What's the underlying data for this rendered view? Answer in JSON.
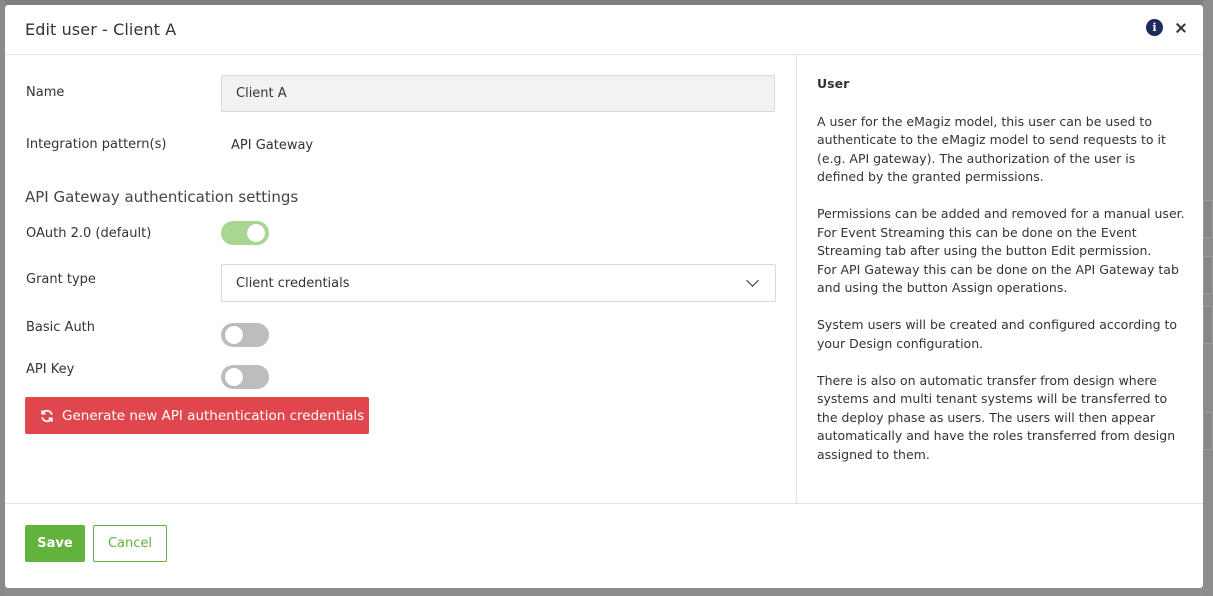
{
  "modal": {
    "title": "Edit user - Client A"
  },
  "form": {
    "name_label": "Name",
    "name_value": "Client A",
    "pattern_label": "Integration pattern(s)",
    "pattern_value": "API Gateway",
    "section_title": "API Gateway authentication settings",
    "oauth_label": "OAuth 2.0 (default)",
    "oauth_enabled": true,
    "grant_label": "Grant type",
    "grant_value": "Client credentials",
    "basic_label": "Basic Auth",
    "basic_enabled": false,
    "apikey_label": "API Key",
    "apikey_enabled": false,
    "generate_label": "Generate new API authentication credentials"
  },
  "help": {
    "title": "User",
    "p1": "A user for the eMagiz model, this user can be used to authenticate to the eMagiz model to send requests to it (e.g. API gateway). The authorization of the user is defined by the granted permissions.",
    "p2a": "Permissions can be added and removed for a manual user.",
    "p2b": "For Event Streaming this can be done on the Event Streaming tab after using the button Edit permission.",
    "p2c": "For API Gateway this can be done on the API Gateway tab and using the button Assign operations.",
    "p3": "System users will be created and configured according to your Design configuration.",
    "p4": "There is also on automatic transfer from design where systems and multi tenant systems will be transferred to the deploy phase as users. The users will then appear automatically and have the roles transferred from design assigned to them."
  },
  "footer": {
    "save_label": "Save",
    "cancel_label": "Cancel"
  },
  "colors": {
    "danger": "#e0474c",
    "success": "#62b33e",
    "toggle_on": "#a8d794",
    "toggle_off": "#bdbdbd",
    "info_icon": "#1d2a5c"
  }
}
